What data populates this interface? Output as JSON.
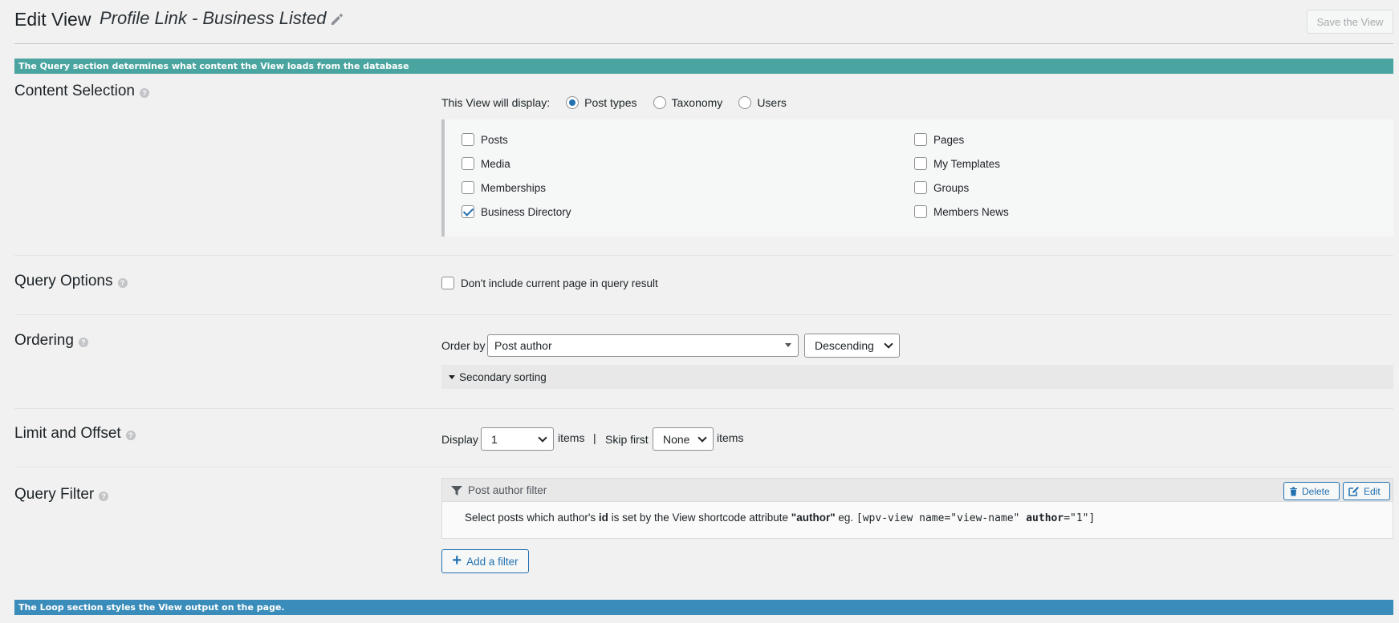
{
  "header": {
    "title": "Edit View",
    "view_name": "Profile Link - Business Listed",
    "save_label": "Save the View"
  },
  "banners": {
    "query": "The Query section determines what content the View loads from the database",
    "loop": "The Loop section styles the View output on the page."
  },
  "content_selection": {
    "label": "Content Selection",
    "display_label": "This View will display:",
    "radios": [
      {
        "label": "Post types",
        "checked": true
      },
      {
        "label": "Taxonomy",
        "checked": false
      },
      {
        "label": "Users",
        "checked": false
      }
    ],
    "post_types_left": [
      {
        "label": "Posts",
        "checked": false
      },
      {
        "label": "Media",
        "checked": false
      },
      {
        "label": "Memberships",
        "checked": false
      },
      {
        "label": "Business Directory",
        "checked": true
      }
    ],
    "post_types_right": [
      {
        "label": "Pages",
        "checked": false
      },
      {
        "label": "My Templates",
        "checked": false
      },
      {
        "label": "Groups",
        "checked": false
      },
      {
        "label": "Members News",
        "checked": false
      }
    ]
  },
  "query_options": {
    "label": "Query Options",
    "exclude_current": "Don't include current page in query result"
  },
  "ordering": {
    "label": "Ordering",
    "order_by_label": "Order by",
    "order_by_value": "Post author",
    "direction_value": "Descending",
    "secondary_sorting": "Secondary sorting"
  },
  "limit_offset": {
    "label": "Limit and Offset",
    "display_label": "Display",
    "display_value": "1",
    "items1": "items",
    "separator": "|",
    "skip_label": "Skip first",
    "skip_value": "None",
    "items2": "items"
  },
  "query_filter": {
    "label": "Query Filter",
    "filter_title": "Post author filter",
    "delete_label": "Delete",
    "edit_label": "Edit",
    "desc_pre": "Select posts which author's ",
    "desc_id": "id",
    "desc_mid": " is set by the View shortcode attribute ",
    "desc_attr": "\"author\"",
    "desc_eg": " eg. ",
    "shortcode_pre": "[wpv-view name=\"view-name\" ",
    "shortcode_attr": "author",
    "shortcode_post": "=\"1\"]",
    "add_filter_label": "Add a filter"
  },
  "help_glyph": "?"
}
